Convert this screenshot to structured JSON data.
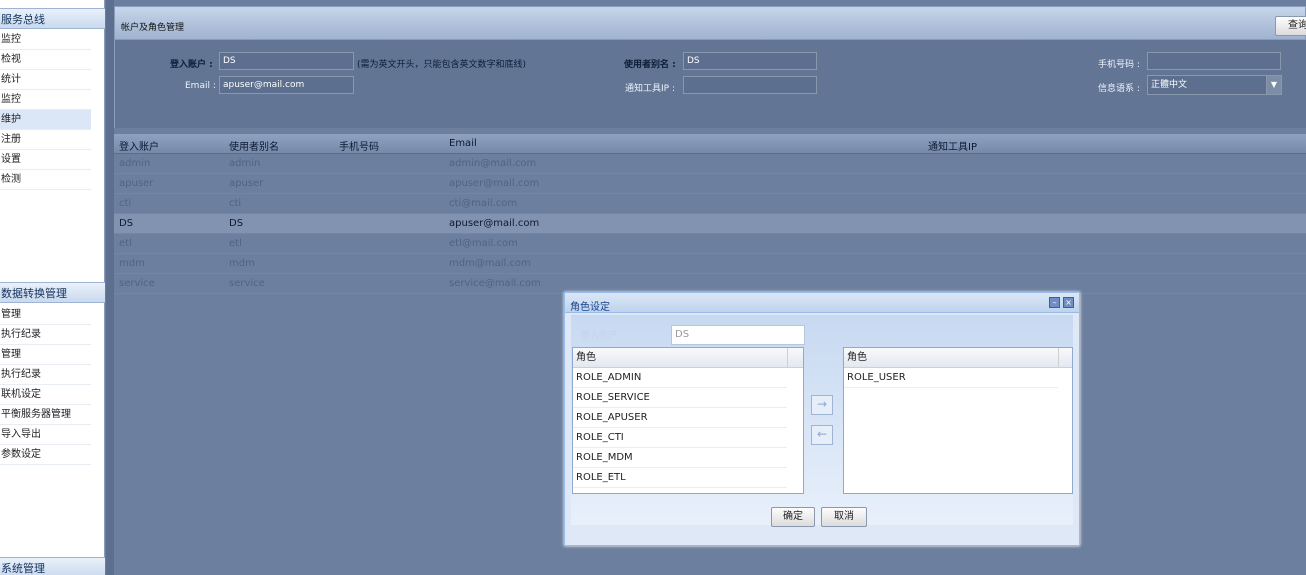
{
  "sidebar": {
    "sections": [
      {
        "title": "服务总线",
        "items": [
          "监控",
          "检视",
          "统计",
          "监控",
          "维护",
          "注册",
          "设置",
          "检测"
        ],
        "selected": 4
      },
      {
        "title": "数据转换管理",
        "items": [
          "管理",
          "执行纪录",
          "管理",
          "执行纪录",
          "联机设定",
          "平衡服务器管理",
          "导入导出",
          "参数设定"
        ]
      },
      {
        "title": "系统管理",
        "items": []
      }
    ]
  },
  "panel": {
    "title": "帐户及角色管理",
    "query_button": "查询"
  },
  "form": {
    "account_label": "登入账户 :",
    "account_value": "DS",
    "account_hint": "(需为英文开头，只能包含英文数字和底线)",
    "alias_label": "使用者别名 :",
    "alias_value": "DS",
    "phone_label": "手机号码 :",
    "phone_value": "",
    "email_label": "Email :",
    "email_value": "apuser@mail.com",
    "notify_label": "通知工具IP :",
    "notify_value": "",
    "lang_label": "信息语系 :",
    "lang_value": "正體中文"
  },
  "grid": {
    "columns": [
      "登入账户",
      "使用者别名",
      "手机号码",
      "Email",
      "通知工具IP"
    ],
    "rows": [
      [
        "admin",
        "admin",
        "",
        "admin@mail.com",
        ""
      ],
      [
        "apuser",
        "apuser",
        "",
        "apuser@mail.com",
        ""
      ],
      [
        "cti",
        "cti",
        "",
        "cti@mail.com",
        ""
      ],
      [
        "DS",
        "DS",
        "",
        "apuser@mail.com",
        ""
      ],
      [
        "etl",
        "etl",
        "",
        "etl@mail.com",
        ""
      ],
      [
        "mdm",
        "mdm",
        "",
        "mdm@mail.com",
        ""
      ],
      [
        "service",
        "service",
        "",
        "service@mail.com",
        ""
      ]
    ],
    "selected_row": 3
  },
  "dialog": {
    "title": "角色设定",
    "account_label": "登入账户",
    "account_value": "DS",
    "available_header": "角色",
    "available_roles": [
      "ROLE_ADMIN",
      "ROLE_SERVICE",
      "ROLE_APUSER",
      "ROLE_CTI",
      "ROLE_MDM",
      "ROLE_ETL"
    ],
    "assigned_header": "角色",
    "assigned_roles": [
      "ROLE_USER"
    ],
    "add_icon": "→",
    "remove_icon": "←",
    "ok_label": "确定",
    "cancel_label": "取消",
    "minimize_icon": "–",
    "close_icon": "×"
  }
}
